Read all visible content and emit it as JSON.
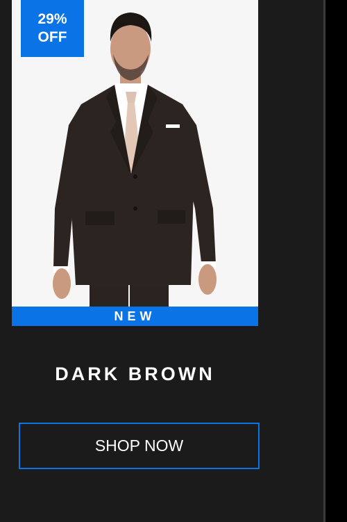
{
  "product": {
    "discount_badge": {
      "line1": "29%",
      "line2": "OFF"
    },
    "ribbon_label": "NEW",
    "title": "DARK BROWN",
    "shop_button_label": "SHOP NOW",
    "image_alt": "Man wearing dark brown suit with white shirt and pink tie"
  },
  "colors": {
    "accent": "#0a73e6",
    "background": "#1b1b1b",
    "image_background": "#f6f6f6",
    "suit": "#2b2421"
  }
}
